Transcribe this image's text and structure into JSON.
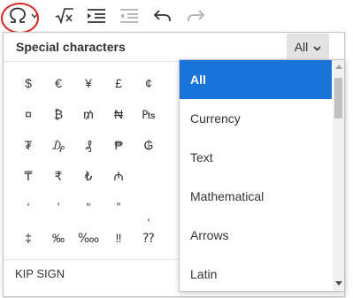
{
  "toolbar": {
    "buttons": [
      {
        "icon": "omega-icon",
        "name": "special-characters"
      },
      {
        "icon": "square-root-icon",
        "name": "math"
      },
      {
        "icon": "indent-icon",
        "name": "indent"
      },
      {
        "icon": "outdent-icon",
        "name": "outdent"
      },
      {
        "icon": "undo-icon",
        "name": "undo"
      },
      {
        "icon": "redo-icon",
        "name": "redo"
      }
    ],
    "highlight_color": "#e02020"
  },
  "panel": {
    "title": "Special characters",
    "category_selected": "All",
    "characters": [
      "$",
      "€",
      "¥",
      "£",
      "¢",
      "¤",
      "₿",
      "₥",
      "₦",
      "₧",
      "₮",
      "₯",
      "₰",
      "₱",
      "₲",
      "₸",
      "₹",
      "₺",
      "₼",
      "",
      "‘",
      "’",
      "“",
      "”",
      "",
      "‡",
      "‰",
      "‱",
      "‼",
      "⁇"
    ],
    "extra_characters": [
      "‚"
    ],
    "footer_label": "KIP SIGN"
  },
  "dropdown": {
    "options": [
      "All",
      "Currency",
      "Text",
      "Mathematical",
      "Arrows",
      "Latin"
    ],
    "selected_index": 0,
    "selected_color": "#1a73d8"
  }
}
